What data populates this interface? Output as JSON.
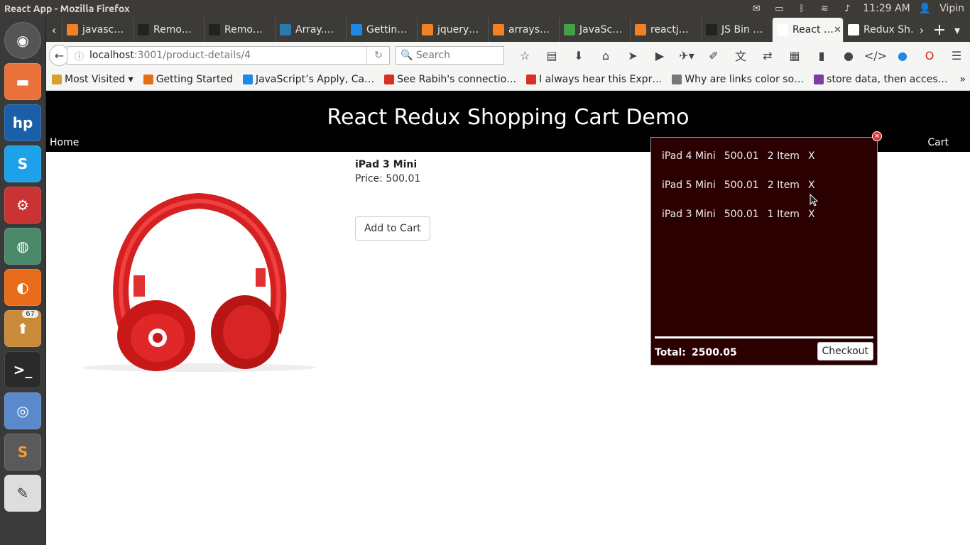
{
  "os": {
    "window_title": "React App - Mozilla Firefox",
    "time": "11:29 AM",
    "user": "Vipin",
    "launcher_badge": "67"
  },
  "browser": {
    "tabs": [
      {
        "label": "javasc…",
        "color": "#f48024"
      },
      {
        "label": "Remo…",
        "color": "#222222"
      },
      {
        "label": "Remo…",
        "color": "#222222"
      },
      {
        "label": "Array.…",
        "color": "#2a7ab0"
      },
      {
        "label": "Gettin…",
        "color": "#1e88e5"
      },
      {
        "label": "jquery…",
        "color": "#f48024"
      },
      {
        "label": "arrays…",
        "color": "#f48024"
      },
      {
        "label": "JavaSc…",
        "color": "#43a047"
      },
      {
        "label": "reactj…",
        "color": "#f48024"
      },
      {
        "label": "JS Bin …",
        "color": "#222222"
      },
      {
        "label": "React …",
        "color": "#ffffff"
      },
      {
        "label": "Redux Sh…",
        "color": "#ffffff"
      }
    ],
    "active_tab_index": 10,
    "url_host": "localhost",
    "url_rest": ":3001/product-details/4",
    "search_placeholder": "Search",
    "bookmarks": [
      {
        "label": "Most Visited ▾",
        "icon": "folder-icon"
      },
      {
        "label": "Getting Started",
        "icon": "firefox-icon"
      },
      {
        "label": "JavaScript’s Apply, Ca…",
        "icon": "js-icon"
      },
      {
        "label": "See Rabih's connectio…",
        "icon": "gmail-icon"
      },
      {
        "label": "I always hear this Expr…",
        "icon": "feed-icon"
      },
      {
        "label": "Why are links color so…",
        "icon": "globe-icon"
      },
      {
        "label": "store data, then acces…",
        "icon": "store-icon"
      }
    ]
  },
  "app": {
    "title": "React Redux Shopping Cart Demo",
    "nav_home": "Home",
    "nav_cart": "Cart",
    "product": {
      "name": "iPad 3 Mini",
      "price_text": "Price: 500.01",
      "add_button": "Add to Cart"
    },
    "cart": {
      "items": [
        {
          "name": "iPad 4 Mini",
          "price": "500.01",
          "qty": "2 Item",
          "remove": "X"
        },
        {
          "name": "iPad 5 Mini",
          "price": "500.01",
          "qty": "2 Item",
          "remove": "X"
        },
        {
          "name": "iPad 3 Mini",
          "price": "500.01",
          "qty": "1 Item",
          "remove": "X"
        }
      ],
      "total_label": "Total:",
      "total_value": "2500.05",
      "checkout_label": "Checkout",
      "close_label": "×"
    }
  }
}
